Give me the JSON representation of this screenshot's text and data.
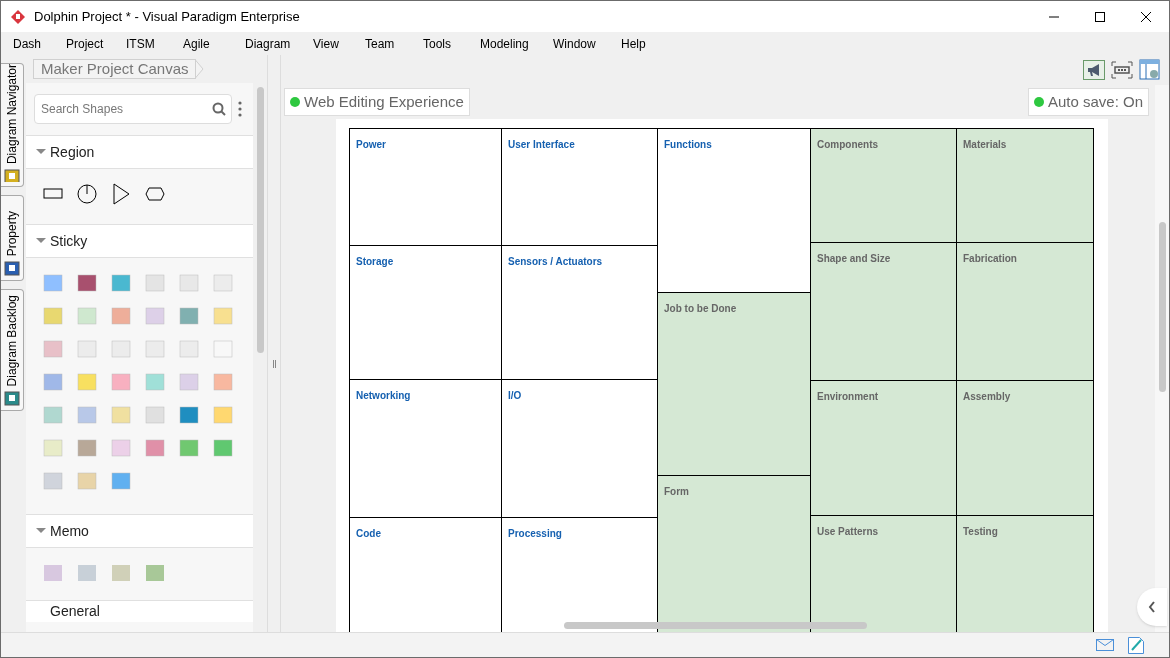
{
  "window": {
    "title": "Dolphin Project * - Visual Paradigm Enterprise"
  },
  "menu": [
    "Dash",
    "Project",
    "ITSM",
    "Agile",
    "Diagram",
    "View",
    "Team",
    "Tools",
    "Modeling",
    "Window",
    "Help"
  ],
  "side_tabs": [
    "Diagram Navigator",
    "Property",
    "Diagram Backlog"
  ],
  "breadcrumb": "Maker Project Canvas",
  "search": {
    "placeholder": "Search Shapes"
  },
  "sections": [
    {
      "label": "Region",
      "kind": "region"
    },
    {
      "label": "Sticky",
      "kind": "sticky"
    },
    {
      "label": "Memo",
      "kind": "memo"
    },
    {
      "label": "General",
      "kind": "general"
    }
  ],
  "web_editing": {
    "label": "Web Editing Experience",
    "on": true
  },
  "auto_save": {
    "label": "Auto save: On",
    "on": true
  },
  "canvas": {
    "columns": [
      {
        "cells": [
          {
            "label": "Power",
            "shaded": false
          },
          {
            "label": "Storage",
            "shaded": false
          },
          {
            "label": "Networking",
            "shaded": false
          },
          {
            "label": "Code",
            "shaded": false
          }
        ]
      },
      {
        "cells": [
          {
            "label": "User Interface",
            "shaded": false
          },
          {
            "label": "Sensors / Actuators",
            "shaded": false
          },
          {
            "label": "I/O",
            "shaded": false
          },
          {
            "label": "Processing",
            "shaded": false
          }
        ]
      },
      {
        "cells": [
          {
            "label": "Functions",
            "shaded": false
          },
          {
            "label": "Job to be Done",
            "shaded": true
          },
          {
            "label": "Form",
            "shaded": true
          }
        ]
      },
      {
        "cells": [
          {
            "label": "Components",
            "shaded": true
          },
          {
            "label": "Shape and Size",
            "shaded": true
          },
          {
            "label": "Environment",
            "shaded": true
          },
          {
            "label": "Use Patterns",
            "shaded": true
          }
        ]
      },
      {
        "cells": [
          {
            "label": "Materials",
            "shaded": true
          },
          {
            "label": "Fabrication",
            "shaded": true
          },
          {
            "label": "Assembly",
            "shaded": true
          },
          {
            "label": "Testing",
            "shaded": true
          }
        ]
      }
    ]
  }
}
